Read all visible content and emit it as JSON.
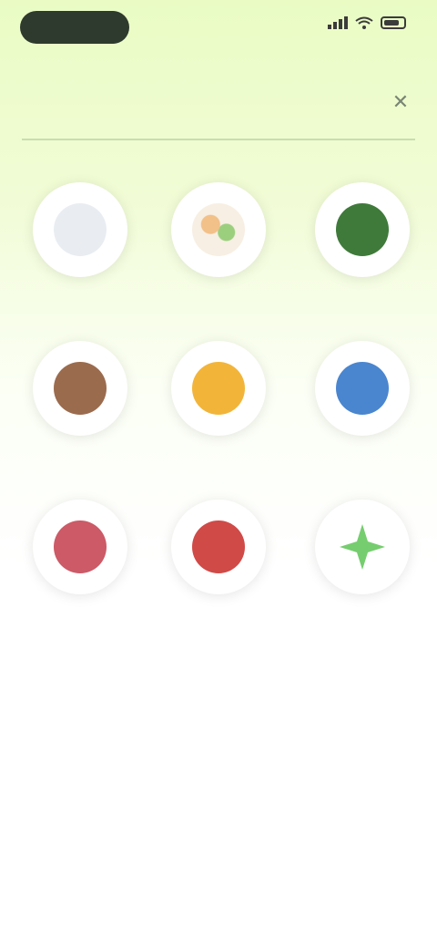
{
  "status_bar": {
    "pill_text": "",
    "icons": [
      "signal-icon",
      "wifi-icon",
      "battery-icon"
    ]
  },
  "header": {
    "title": "",
    "close_icon": "close-icon"
  },
  "grid": [
    {
      "label": "",
      "icon": "white-apparel-icon",
      "color": "#e9edf2"
    },
    {
      "label": "",
      "icon": "mixed-color-icon",
      "color": "#f3e6d1"
    },
    {
      "label": "",
      "icon": "green-item-icon",
      "color": "#3f7a3a"
    },
    {
      "label": "",
      "icon": "brown-item-icon",
      "color": "#9b6b4e"
    },
    {
      "label": "",
      "icon": "yellow-item-icon",
      "color": "#f2b53a"
    },
    {
      "label": "",
      "icon": "blue-item-icon",
      "color": "#4a86cf"
    },
    {
      "label": "",
      "icon": "pink-red-item-icon",
      "color": "#cc5a67"
    },
    {
      "label": "",
      "icon": "red-item-icon",
      "color": "#d04a47"
    },
    {
      "label": "",
      "icon": "green-star-icon",
      "color": "#67c85f"
    }
  ]
}
